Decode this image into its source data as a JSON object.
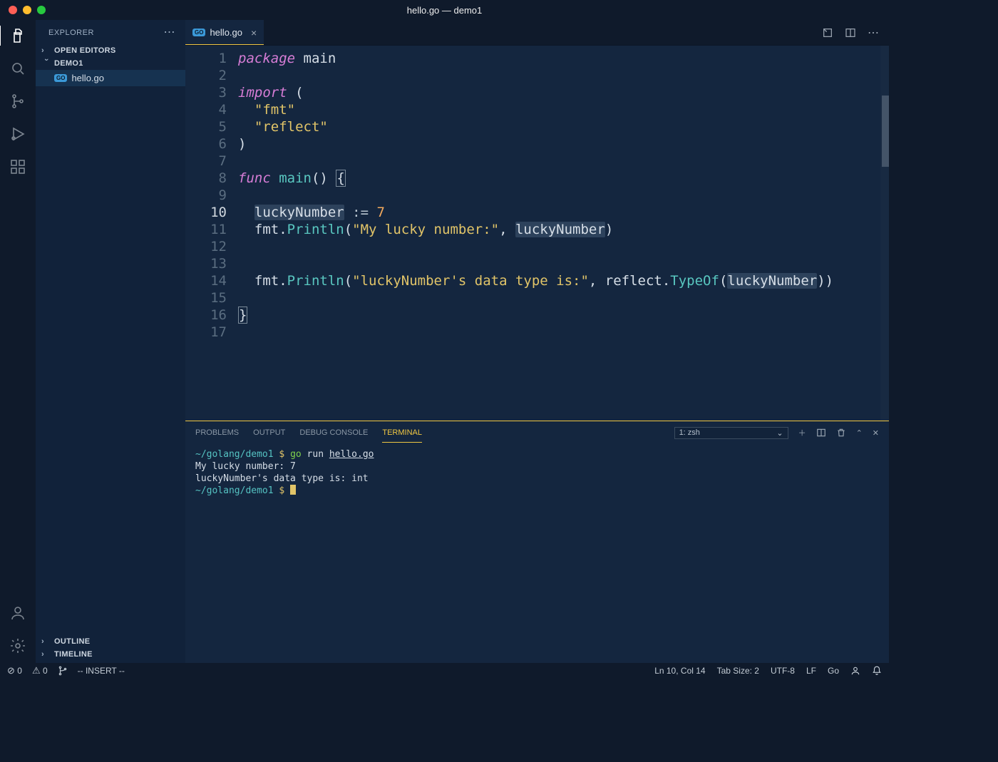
{
  "window": {
    "title": "hello.go — demo1"
  },
  "sidebar": {
    "title": "EXPLORER",
    "sections": {
      "open_editors": "OPEN EDITORS",
      "project": "DEMO1",
      "outline": "OUTLINE",
      "timeline": "TIMELINE"
    },
    "files": [
      {
        "name": "hello.go",
        "icon": "GO"
      }
    ]
  },
  "tabs": [
    {
      "name": "hello.go",
      "icon": "GO"
    }
  ],
  "editor": {
    "line_numbers": [
      "1",
      "2",
      "3",
      "4",
      "5",
      "6",
      "7",
      "8",
      "9",
      "10",
      "11",
      "12",
      "13",
      "14",
      "15",
      "16",
      "17"
    ],
    "current_line": 10,
    "code_tokens": [
      [
        {
          "t": "package",
          "c": "kw"
        },
        {
          "t": " "
        },
        {
          "t": "main",
          "c": "pkg"
        }
      ],
      [],
      [
        {
          "t": "import",
          "c": "kw"
        },
        {
          "t": " ("
        }
      ],
      [
        {
          "t": "  "
        },
        {
          "t": "\"fmt\"",
          "c": "str"
        }
      ],
      [
        {
          "t": "  "
        },
        {
          "t": "\"reflect\"",
          "c": "str"
        }
      ],
      [
        {
          "t": ")"
        }
      ],
      [],
      [
        {
          "t": "func",
          "c": "kw"
        },
        {
          "t": " "
        },
        {
          "t": "main",
          "c": "fn"
        },
        {
          "t": "() "
        },
        {
          "t": "{",
          "c": "brace-match"
        }
      ],
      [],
      [
        {
          "t": "  "
        },
        {
          "t": "luckyNumber",
          "c": "hl-word"
        },
        {
          "t": " := ",
          "c": "op"
        },
        {
          "t": "7",
          "c": "num"
        }
      ],
      [
        {
          "t": "  fmt."
        },
        {
          "t": "Println",
          "c": "fn"
        },
        {
          "t": "("
        },
        {
          "t": "\"My lucky number:\"",
          "c": "str"
        },
        {
          "t": ", "
        },
        {
          "t": "luckyNumber",
          "c": "hl-word"
        },
        {
          "t": ")"
        }
      ],
      [],
      [],
      [
        {
          "t": "  fmt."
        },
        {
          "t": "Println",
          "c": "fn"
        },
        {
          "t": "("
        },
        {
          "t": "\"luckyNumber's data type is:\"",
          "c": "str"
        },
        {
          "t": ", reflect."
        },
        {
          "t": "TypeOf",
          "c": "fn"
        },
        {
          "t": "("
        },
        {
          "t": "luckyNumber",
          "c": "hl-word"
        },
        {
          "t": "))"
        }
      ],
      [],
      [
        {
          "t": "}",
          "c": "brace-match"
        }
      ],
      []
    ]
  },
  "panel": {
    "tabs": [
      "PROBLEMS",
      "OUTPUT",
      "DEBUG CONSOLE",
      "TERMINAL"
    ],
    "active_tab": "TERMINAL",
    "terminal_selector": "1: zsh"
  },
  "terminal": {
    "prompt_path": "~/golang/demo1",
    "prompt_char": "$",
    "command": "go",
    "command_args": "run",
    "command_file": "hello.go",
    "output": [
      "My lucky number: 7",
      "luckyNumber's data type is: int"
    ]
  },
  "statusbar": {
    "errors": "0",
    "warnings": "0",
    "vim_mode": "-- INSERT --",
    "cursor": "Ln 10, Col 14",
    "tab_size": "Tab Size: 2",
    "encoding": "UTF-8",
    "eol": "LF",
    "language": "Go"
  }
}
